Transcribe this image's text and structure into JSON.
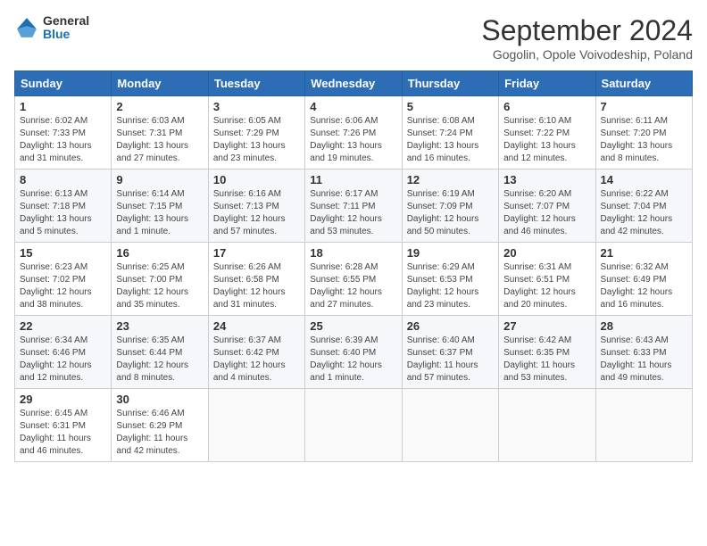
{
  "header": {
    "logo_general": "General",
    "logo_blue": "Blue",
    "month_year": "September 2024",
    "location": "Gogolin, Opole Voivodeship, Poland"
  },
  "weekdays": [
    "Sunday",
    "Monday",
    "Tuesday",
    "Wednesday",
    "Thursday",
    "Friday",
    "Saturday"
  ],
  "weeks": [
    [
      {
        "day": "1",
        "sunrise": "6:02 AM",
        "sunset": "7:33 PM",
        "daylight": "13 hours and 31 minutes."
      },
      {
        "day": "2",
        "sunrise": "6:03 AM",
        "sunset": "7:31 PM",
        "daylight": "13 hours and 27 minutes."
      },
      {
        "day": "3",
        "sunrise": "6:05 AM",
        "sunset": "7:29 PM",
        "daylight": "13 hours and 23 minutes."
      },
      {
        "day": "4",
        "sunrise": "6:06 AM",
        "sunset": "7:26 PM",
        "daylight": "13 hours and 19 minutes."
      },
      {
        "day": "5",
        "sunrise": "6:08 AM",
        "sunset": "7:24 PM",
        "daylight": "13 hours and 16 minutes."
      },
      {
        "day": "6",
        "sunrise": "6:10 AM",
        "sunset": "7:22 PM",
        "daylight": "13 hours and 12 minutes."
      },
      {
        "day": "7",
        "sunrise": "6:11 AM",
        "sunset": "7:20 PM",
        "daylight": "13 hours and 8 minutes."
      }
    ],
    [
      {
        "day": "8",
        "sunrise": "6:13 AM",
        "sunset": "7:18 PM",
        "daylight": "13 hours and 5 minutes."
      },
      {
        "day": "9",
        "sunrise": "6:14 AM",
        "sunset": "7:15 PM",
        "daylight": "13 hours and 1 minute."
      },
      {
        "day": "10",
        "sunrise": "6:16 AM",
        "sunset": "7:13 PM",
        "daylight": "12 hours and 57 minutes."
      },
      {
        "day": "11",
        "sunrise": "6:17 AM",
        "sunset": "7:11 PM",
        "daylight": "12 hours and 53 minutes."
      },
      {
        "day": "12",
        "sunrise": "6:19 AM",
        "sunset": "7:09 PM",
        "daylight": "12 hours and 50 minutes."
      },
      {
        "day": "13",
        "sunrise": "6:20 AM",
        "sunset": "7:07 PM",
        "daylight": "12 hours and 46 minutes."
      },
      {
        "day": "14",
        "sunrise": "6:22 AM",
        "sunset": "7:04 PM",
        "daylight": "12 hours and 42 minutes."
      }
    ],
    [
      {
        "day": "15",
        "sunrise": "6:23 AM",
        "sunset": "7:02 PM",
        "daylight": "12 hours and 38 minutes."
      },
      {
        "day": "16",
        "sunrise": "6:25 AM",
        "sunset": "7:00 PM",
        "daylight": "12 hours and 35 minutes."
      },
      {
        "day": "17",
        "sunrise": "6:26 AM",
        "sunset": "6:58 PM",
        "daylight": "12 hours and 31 minutes."
      },
      {
        "day": "18",
        "sunrise": "6:28 AM",
        "sunset": "6:55 PM",
        "daylight": "12 hours and 27 minutes."
      },
      {
        "day": "19",
        "sunrise": "6:29 AM",
        "sunset": "6:53 PM",
        "daylight": "12 hours and 23 minutes."
      },
      {
        "day": "20",
        "sunrise": "6:31 AM",
        "sunset": "6:51 PM",
        "daylight": "12 hours and 20 minutes."
      },
      {
        "day": "21",
        "sunrise": "6:32 AM",
        "sunset": "6:49 PM",
        "daylight": "12 hours and 16 minutes."
      }
    ],
    [
      {
        "day": "22",
        "sunrise": "6:34 AM",
        "sunset": "6:46 PM",
        "daylight": "12 hours and 12 minutes."
      },
      {
        "day": "23",
        "sunrise": "6:35 AM",
        "sunset": "6:44 PM",
        "daylight": "12 hours and 8 minutes."
      },
      {
        "day": "24",
        "sunrise": "6:37 AM",
        "sunset": "6:42 PM",
        "daylight": "12 hours and 4 minutes."
      },
      {
        "day": "25",
        "sunrise": "6:39 AM",
        "sunset": "6:40 PM",
        "daylight": "12 hours and 1 minute."
      },
      {
        "day": "26",
        "sunrise": "6:40 AM",
        "sunset": "6:37 PM",
        "daylight": "11 hours and 57 minutes."
      },
      {
        "day": "27",
        "sunrise": "6:42 AM",
        "sunset": "6:35 PM",
        "daylight": "11 hours and 53 minutes."
      },
      {
        "day": "28",
        "sunrise": "6:43 AM",
        "sunset": "6:33 PM",
        "daylight": "11 hours and 49 minutes."
      }
    ],
    [
      {
        "day": "29",
        "sunrise": "6:45 AM",
        "sunset": "6:31 PM",
        "daylight": "11 hours and 46 minutes."
      },
      {
        "day": "30",
        "sunrise": "6:46 AM",
        "sunset": "6:29 PM",
        "daylight": "11 hours and 42 minutes."
      },
      null,
      null,
      null,
      null,
      null
    ]
  ]
}
